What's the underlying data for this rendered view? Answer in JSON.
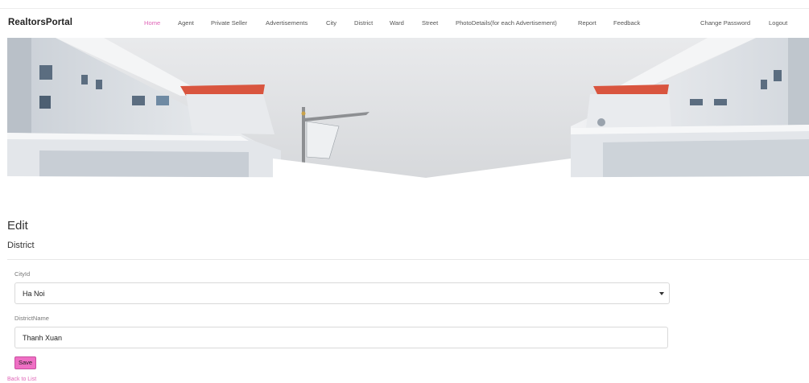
{
  "navbar": {
    "brand": "RealtorsPortal",
    "items": [
      {
        "label": "Home",
        "active": true
      },
      {
        "label": "Agent"
      },
      {
        "label": "Private Seller"
      },
      {
        "label": "Advertisements"
      },
      {
        "label": "City"
      },
      {
        "label": "District"
      },
      {
        "label": "Ward"
      },
      {
        "label": "Street"
      },
      {
        "label": "PhotoDetails(for each Advertisement)"
      },
      {
        "label": "Report"
      },
      {
        "label": "Feedback"
      }
    ],
    "right": [
      {
        "label": "Change Password"
      },
      {
        "label": "Logout"
      }
    ]
  },
  "banner": {
    "icon": "building-banner-image"
  },
  "page": {
    "title": "Edit",
    "subtitle": "District"
  },
  "form": {
    "city": {
      "label": "CityId",
      "value": "Ha Noi"
    },
    "district": {
      "label": "DistrictName",
      "value": "Thanh Xuan"
    },
    "save_label": "Save",
    "back_label": "Back to List"
  },
  "colors": {
    "accent": "#ef6fc4",
    "link": "#e066b8"
  }
}
